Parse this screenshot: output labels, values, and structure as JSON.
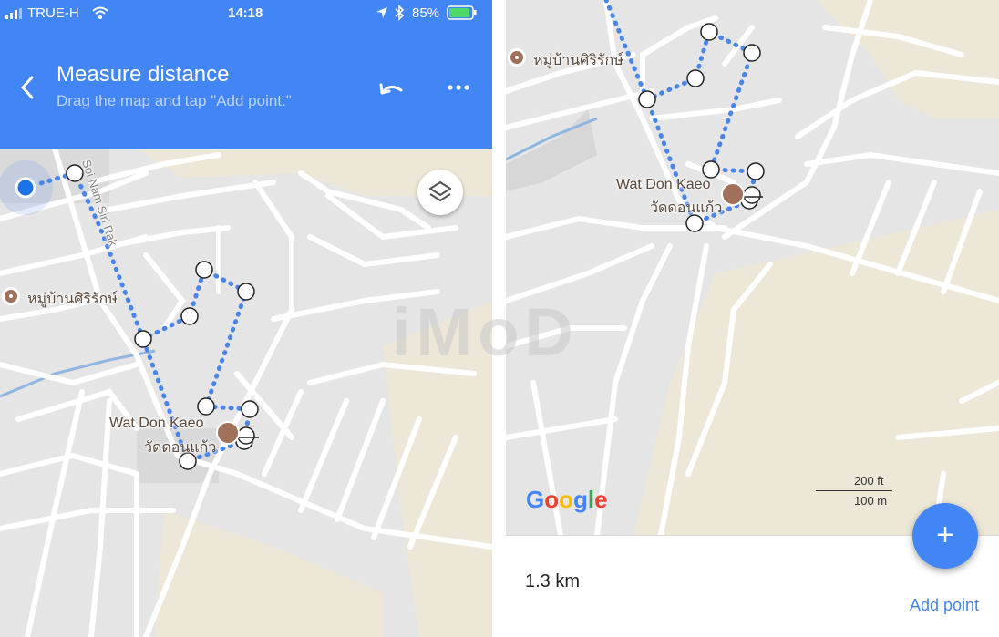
{
  "status_bar": {
    "carrier": "TRUE-H",
    "time": "14:18",
    "battery": "85%"
  },
  "header": {
    "title": "Measure distance",
    "subtitle": "Drag the map and tap \"Add point.\""
  },
  "map": {
    "left_street_label": "Soi Nam Siri Rak",
    "village_label": "หมู่บ้านศิริรักษ์",
    "temple_label_en": "Wat Don Kaeo",
    "temple_label_th": "วัดดอนแก้ว"
  },
  "right_map": {
    "village_label": "หมู่บ้านศิริรักษ์",
    "temple_label_en": "Wat Don Kaeo",
    "temple_label_th": "วัดดอนแก้ว",
    "google_letters": [
      "G",
      "o",
      "o",
      "g",
      "l",
      "e"
    ],
    "scale_ft": "200 ft",
    "scale_m": "100 m"
  },
  "sheet": {
    "distance": "1.3 km",
    "add_point_label": "Add point",
    "fab_label": "+"
  },
  "watermark": "iMoD",
  "colors": {
    "accent": "#4285f4",
    "route": "#4a86e8",
    "poi": "#a0705a",
    "google": [
      "#4285f4",
      "#ea4335",
      "#fbbc05",
      "#4285f4",
      "#34a853",
      "#ea4335"
    ]
  },
  "icons": [
    "back-arrow-icon",
    "undo-icon",
    "more-icon",
    "layers-icon",
    "location-dot-icon",
    "wifi-icon",
    "signal-icon",
    "bluetooth-icon",
    "location-arrow-icon",
    "battery-icon",
    "temple-icon",
    "poi-icon",
    "plus-icon"
  ]
}
